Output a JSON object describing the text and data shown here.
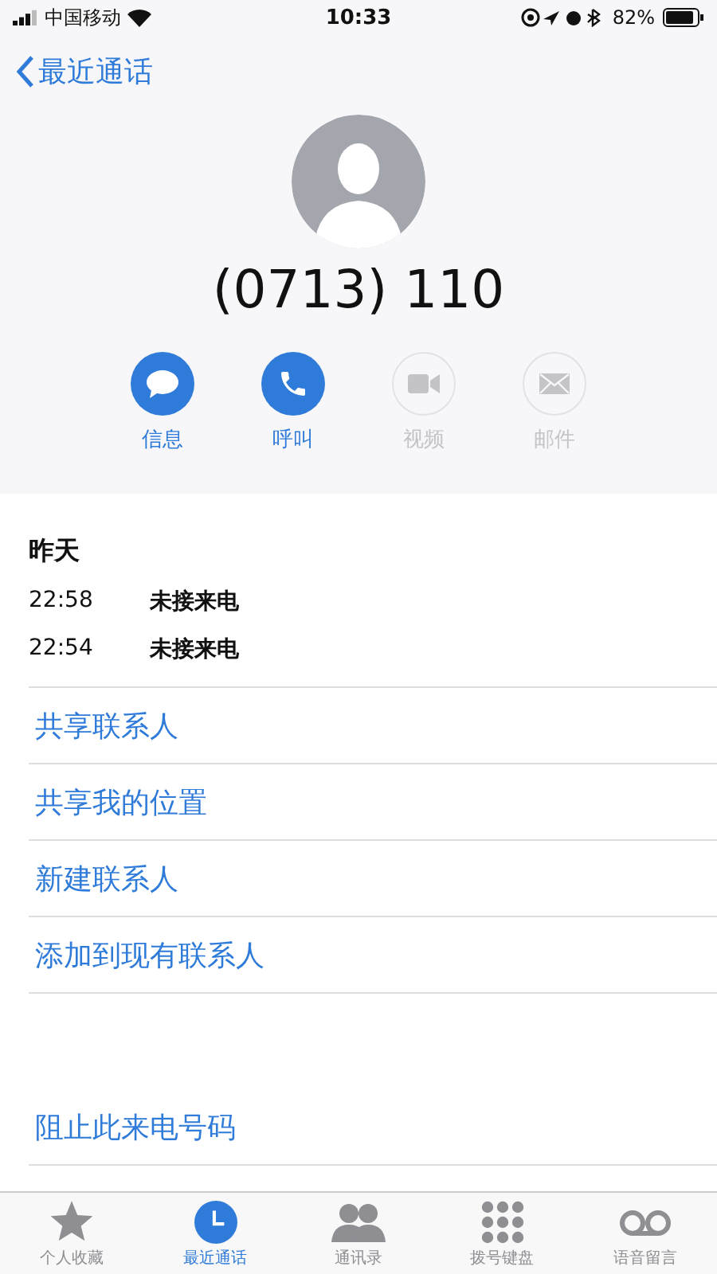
{
  "status_bar": {
    "carrier": "中国移动",
    "time": "10:33",
    "battery": "82%"
  },
  "nav": {
    "back": "最近通话"
  },
  "contact": {
    "number": "(0713) 110"
  },
  "actions": [
    {
      "kind": "message",
      "label": "信息",
      "disabled": false
    },
    {
      "kind": "call",
      "label": "呼叫",
      "disabled": false
    },
    {
      "kind": "video",
      "label": "视频",
      "disabled": true
    },
    {
      "kind": "mail",
      "label": "邮件",
      "disabled": true
    }
  ],
  "history": {
    "date": "昨天",
    "calls": [
      {
        "time": "22:58",
        "type": "未接来电"
      },
      {
        "time": "22:54",
        "type": "未接来电"
      }
    ]
  },
  "links": [
    "共享联系人",
    "共享我的位置",
    "新建联系人",
    "添加到现有联系人"
  ],
  "block": "阻止此来电号码",
  "tabs": [
    {
      "kind": "favorites",
      "label": "个人收藏",
      "selected": false
    },
    {
      "kind": "recents",
      "label": "最近通话",
      "selected": true
    },
    {
      "kind": "contacts",
      "label": "通讯录",
      "selected": false
    },
    {
      "kind": "keypad",
      "label": "拨号键盘",
      "selected": false
    },
    {
      "kind": "voicemail",
      "label": "语音留言",
      "selected": false
    }
  ]
}
